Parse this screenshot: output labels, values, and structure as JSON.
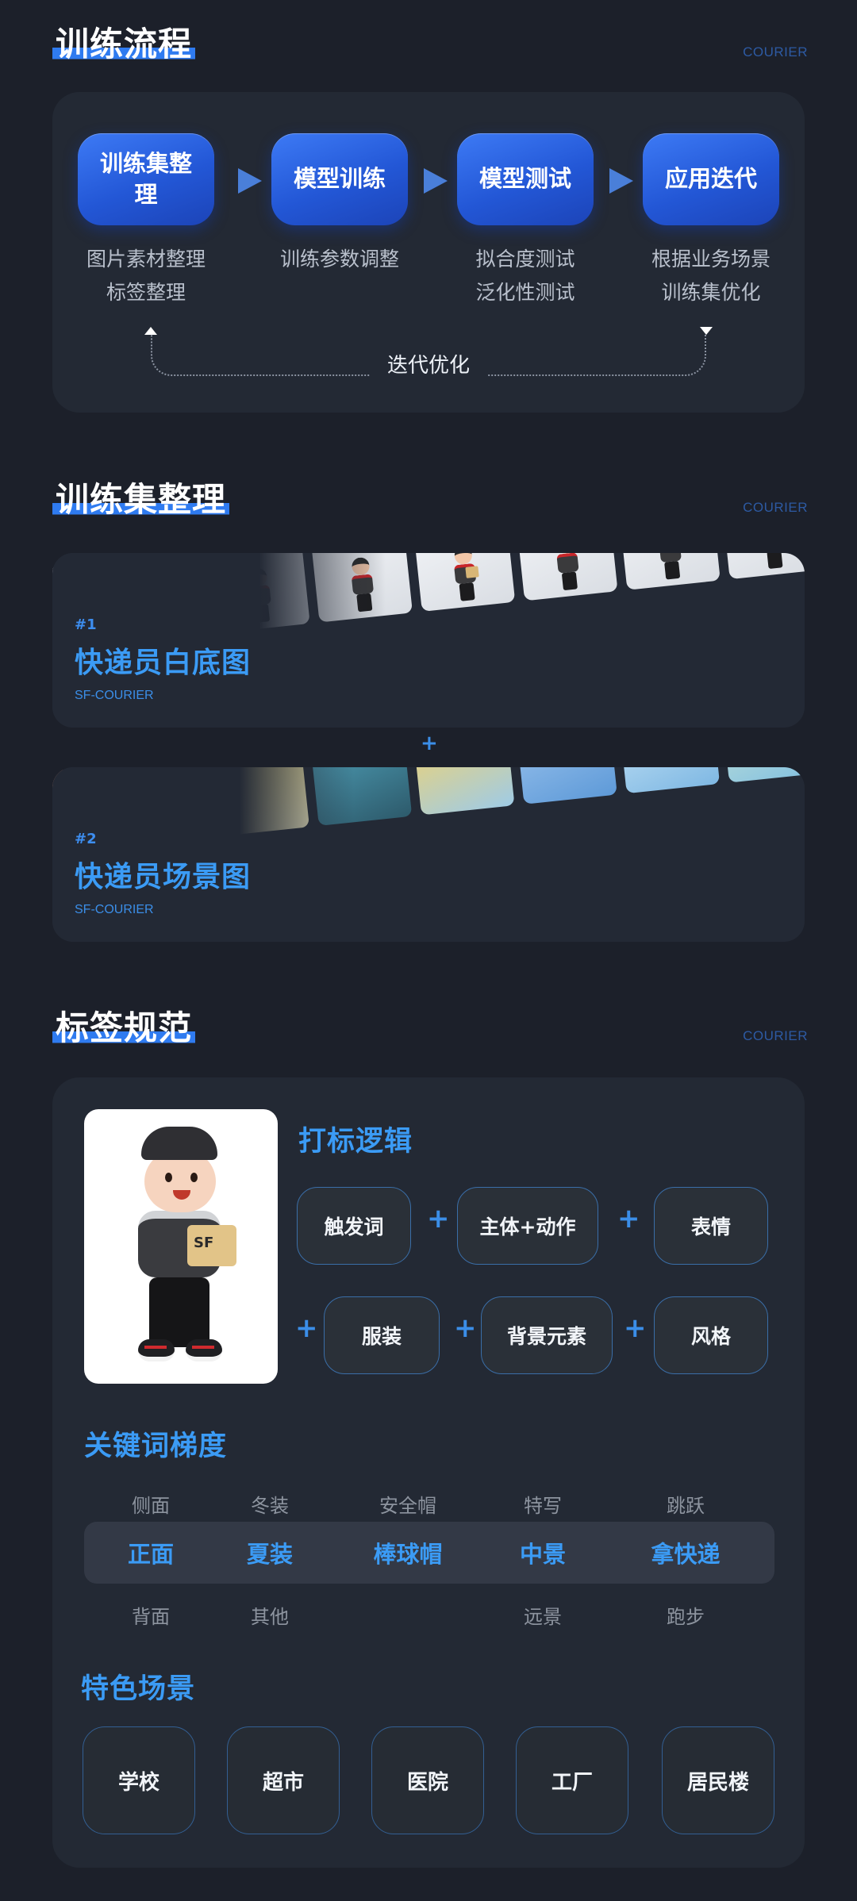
{
  "sections": {
    "process": {
      "title": "训练流程",
      "tag": "COURIER"
    },
    "dataset": {
      "title": "训练集整理",
      "tag": "COURIER"
    },
    "labels": {
      "title": "标签规范",
      "tag": "COURIER"
    }
  },
  "flow": {
    "steps": [
      {
        "label": "训练集整理",
        "desc1": "图片素材整理",
        "desc2": "标签整理"
      },
      {
        "label": "模型训练",
        "desc1": "训练参数调整",
        "desc2": ""
      },
      {
        "label": "模型测试",
        "desc1": "拟合度测试",
        "desc2": "泛化性测试"
      },
      {
        "label": "应用迭代",
        "desc1": "根据业务场景",
        "desc2": "训练集优化"
      }
    ],
    "loop_label": "迭代优化"
  },
  "datasets": [
    {
      "num": "#1",
      "title": "快递员白底图",
      "sub": "SF-COURIER"
    },
    {
      "num": "#2",
      "title": "快递员场景图",
      "sub": "SF-COURIER"
    }
  ],
  "dataset_sep": "+",
  "logic": {
    "title": "打标逻辑",
    "row1": [
      "触发词",
      "主体+动作",
      "表情"
    ],
    "row2": [
      "服装",
      "背景元素",
      "风格"
    ],
    "plus": "+",
    "box_text": "SF"
  },
  "keywords": {
    "title": "关键词梯度",
    "top": [
      "侧面",
      "冬装",
      "安全帽",
      "特写",
      "跳跃"
    ],
    "mid": [
      "正面",
      "夏装",
      "棒球帽",
      "中景",
      "拿快递"
    ],
    "bot": [
      "背面",
      "其他",
      "",
      "远景",
      "跑步"
    ]
  },
  "scenes": {
    "title": "特色场景",
    "items": [
      "学校",
      "超市",
      "医院",
      "工厂",
      "居民楼"
    ]
  }
}
